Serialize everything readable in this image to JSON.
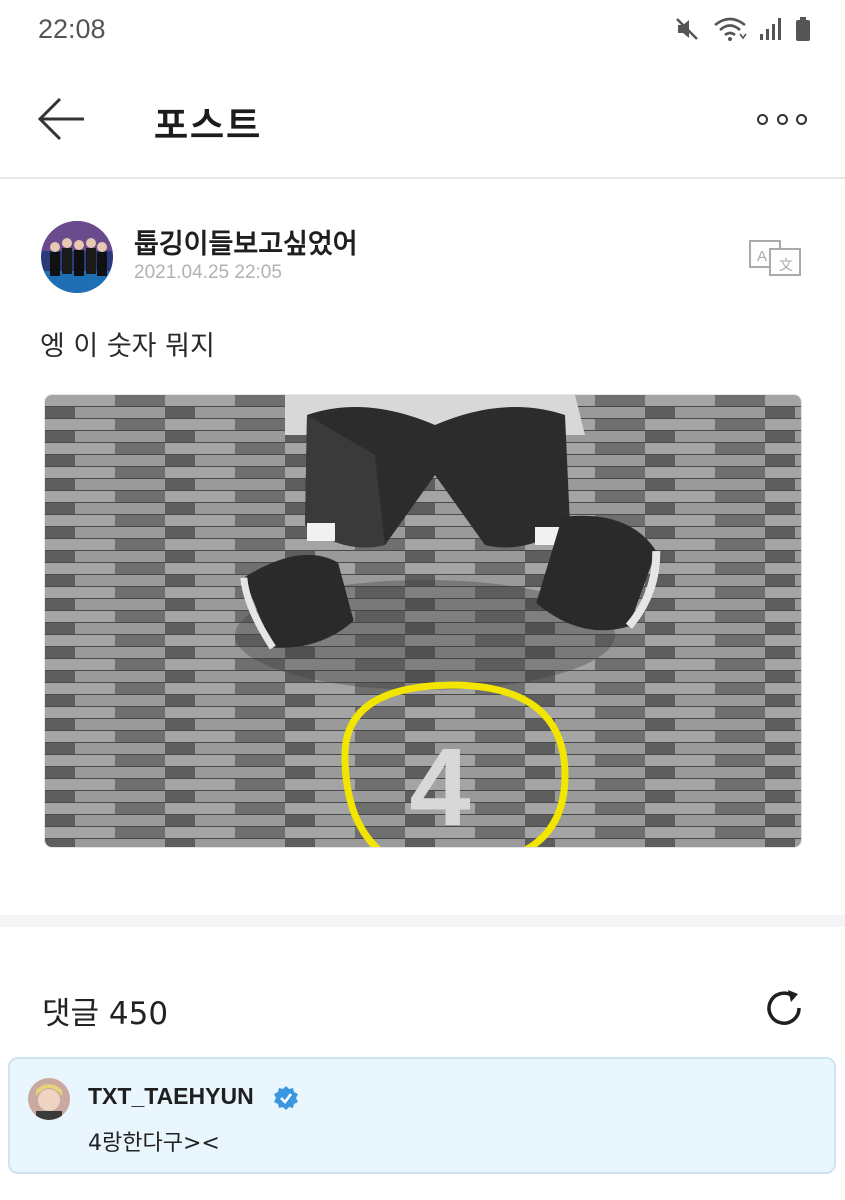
{
  "status_bar": {
    "time": "22:08",
    "icons": [
      "mute-icon",
      "wifi-icon",
      "signal-icon",
      "battery-icon"
    ]
  },
  "header": {
    "title": "포스트",
    "back_icon": "back-arrow-icon",
    "more_icon": "more-options-icon"
  },
  "post": {
    "author": "툽깅이들보고싶었어",
    "date": "2021.04.25 22:05",
    "text": "엥 이 숫자 뭐지",
    "translate_icon": "translate-icon",
    "image": {
      "floor_number": "4",
      "highlight_color": "#f2e600"
    }
  },
  "comments": {
    "label": "댓글 450",
    "refresh_icon": "refresh-icon",
    "items": [
      {
        "author": "TXT_TAEHYUN",
        "verified": true,
        "text": "4랑한다구><"
      }
    ]
  },
  "colors": {
    "comment_bg": "#eaf6fd",
    "verified": "#3b97e0",
    "date_gray": "#b2b2b2"
  }
}
